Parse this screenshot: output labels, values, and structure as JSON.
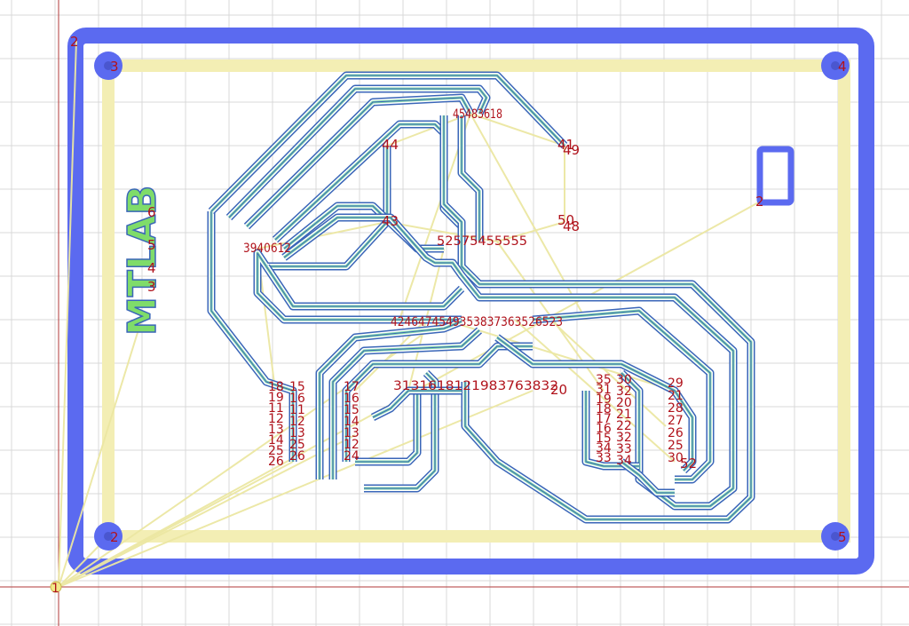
{
  "colors": {
    "background": "#ffffff",
    "grid": "#d9d9d9",
    "origin_axis": "#b23a3a",
    "board_outline": "#5b6af0",
    "rail": "#f3eeb4",
    "ratsnest": "#ece7a3",
    "trace_outer": "#3a66b8",
    "trace_inner": "#7fd6a8",
    "label": "#b0121b"
  },
  "board": {
    "silkscreen_text": "MTLAB",
    "silkscreen_side_labels": [
      "6",
      "5",
      "4",
      "3"
    ]
  },
  "origin_label": "1",
  "corner_labels": {
    "top_left_corner": "2",
    "top_left_hole": "3",
    "top_right_hole": "4",
    "bottom_left_hole": "2",
    "bottom_right_hole": "5",
    "slot": "2"
  },
  "pin_labels": {
    "a41": "41",
    "a49": "49",
    "a44": "44",
    "a43": "43",
    "a50": "50",
    "a48": "48",
    "top_cluster": "45483618",
    "left_cluster": "3940612",
    "mid_cluster": "52575455555",
    "center_cluster": "4246474549353837363526523",
    "lower_row": "3131618121983763832",
    "a20": "20",
    "left_col_a": [
      "18",
      "19",
      "11",
      "12",
      "13",
      "14",
      "25",
      "26"
    ],
    "left_col_b": [
      "15",
      "16",
      "11",
      "12",
      "13",
      "25",
      "26"
    ],
    "mid_col": [
      "17",
      "16",
      "15",
      "14",
      "13",
      "12",
      "24"
    ],
    "right_col_a": [
      "35",
      "31",
      "19",
      "18",
      "17",
      "16",
      "15",
      "34",
      "33"
    ],
    "right_col_b": [
      "30",
      "32",
      "20",
      "21",
      "22",
      "32",
      "33",
      "34"
    ],
    "far_right_col": [
      "29",
      "21",
      "28",
      "27",
      "26",
      "25",
      "30"
    ],
    "a52": "52"
  }
}
